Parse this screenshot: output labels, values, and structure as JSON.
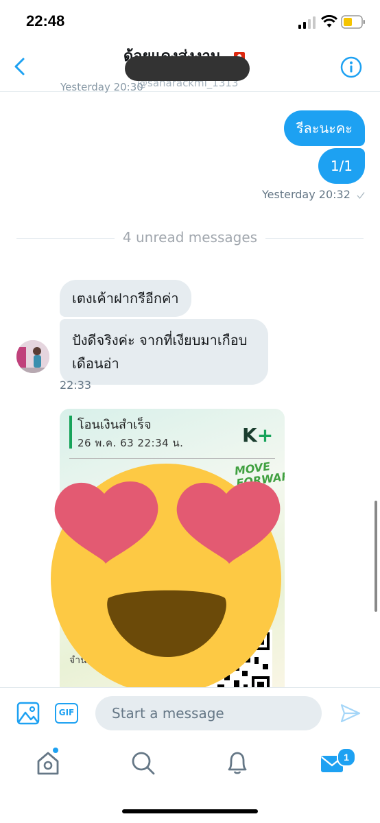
{
  "status": {
    "time": "22:48"
  },
  "header": {
    "title": "ด้อยแดงส่งงาน",
    "handle": "@saharackmi_1313",
    "top_timestamp": "Yesterday 20:30"
  },
  "outgoing": {
    "messages": [
      "รีละนะคะ",
      "1/1"
    ],
    "timestamp": "Yesterday 20:32"
  },
  "divider": {
    "text": "4 unread messages"
  },
  "incoming": {
    "messages": [
      "เตงเค้าฝากรีอีกค่า",
      "ปังดีจริงค่ะ จากที่เงียบมาเกือบเดือนอ่า"
    ],
    "timestamp": "22:33"
  },
  "receipt": {
    "title": "โอนเงินสำเร็จ",
    "date": "26 พ.ค. 63  22:34 น.",
    "logo_k": "K",
    "logo_plus": "+",
    "move": "MOVE",
    "forward": "FORWARD",
    "amount_label": "จำนวน"
  },
  "compose": {
    "placeholder": "Start a message",
    "gif_label": "GIF"
  },
  "tabs": {
    "messages_badge": "1"
  },
  "colors": {
    "accent": "#1da1f2",
    "bubble_in": "#e6ecf0"
  },
  "icons": [
    "back-chevron-icon",
    "info-icon",
    "image-icon",
    "gif-icon",
    "send-icon",
    "home-icon",
    "search-icon",
    "bell-icon",
    "mail-icon",
    "heart-eyes-emoji-icon"
  ]
}
